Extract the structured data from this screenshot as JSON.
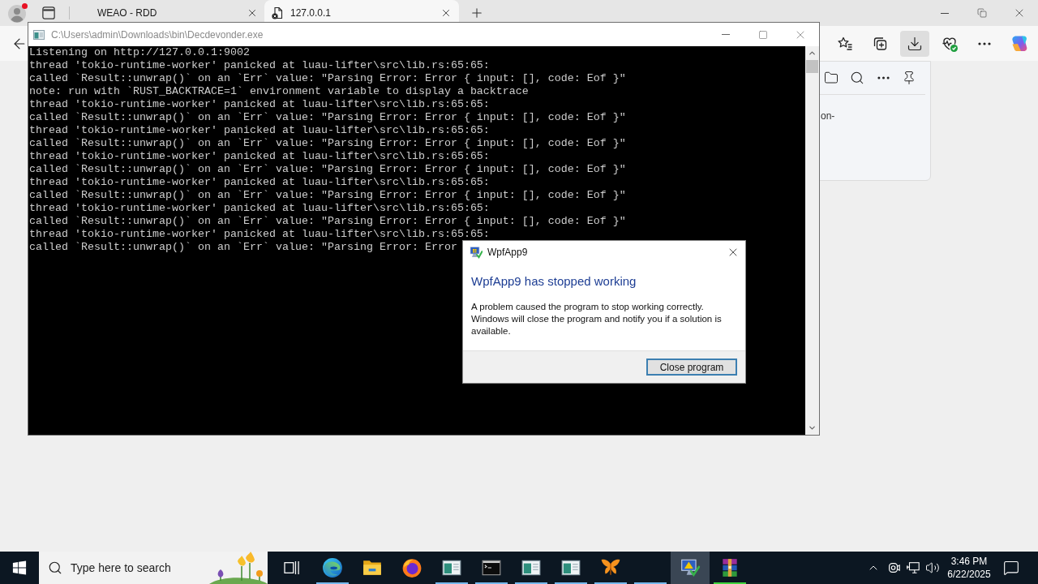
{
  "browser": {
    "tabs": [
      {
        "title": "WEAO - RDD",
        "kind": "plain",
        "selected": false
      },
      {
        "title": "127.0.0.1",
        "kind": "file-error",
        "selected": true
      }
    ],
    "toolbar": [
      {
        "kind": "favorites",
        "selected": false
      },
      {
        "kind": "collections",
        "selected": false
      },
      {
        "kind": "downloads",
        "selected": true
      },
      {
        "kind": "essentials",
        "selected": false
      },
      {
        "kind": "more",
        "selected": false
      },
      {
        "kind": "copilot",
        "selected": false
      }
    ],
    "downloads_panel": {
      "item_text": "on-"
    }
  },
  "console_window": {
    "title": "C:\\Users\\admin\\Downloads\\bin\\Decdevonder.exe",
    "lines": [
      "Listening on http://127.0.0.1:9002",
      "thread 'tokio-runtime-worker' panicked at luau-lifter\\src\\lib.rs:65:65:",
      "called `Result::unwrap()` on an `Err` value: \"Parsing Error: Error { input: [], code: Eof }\"",
      "note: run with `RUST_BACKTRACE=1` environment variable to display a backtrace",
      "thread 'tokio-runtime-worker' panicked at luau-lifter\\src\\lib.rs:65:65:",
      "called `Result::unwrap()` on an `Err` value: \"Parsing Error: Error { input: [], code: Eof }\"",
      "thread 'tokio-runtime-worker' panicked at luau-lifter\\src\\lib.rs:65:65:",
      "called `Result::unwrap()` on an `Err` value: \"Parsing Error: Error { input: [], code: Eof }\"",
      "thread 'tokio-runtime-worker' panicked at luau-lifter\\src\\lib.rs:65:65:",
      "called `Result::unwrap()` on an `Err` value: \"Parsing Error: Error { input: [], code: Eof }\"",
      "thread 'tokio-runtime-worker' panicked at luau-lifter\\src\\lib.rs:65:65:",
      "called `Result::unwrap()` on an `Err` value: \"Parsing Error: Error { input: [], code: Eof }\"",
      "thread 'tokio-runtime-worker' panicked at luau-lifter\\src\\lib.rs:65:65:",
      "called `Result::unwrap()` on an `Err` value: \"Parsing Error: Error { input: [], code: Eof }\"",
      "thread 'tokio-runtime-worker' panicked at luau-lifter\\src\\lib.rs:65:65:",
      "called `Result::unwrap()` on an `Err` value: \"Parsing Error: Error"
    ]
  },
  "error_dialog": {
    "title": "WpfApp9",
    "heading": "WpfApp9 has stopped working",
    "message": "A problem caused the program to stop working correctly. Windows will close the program and notify you if a solution is available.",
    "button": "Close program"
  },
  "taskbar": {
    "search": {
      "placeholder": "Type here to search"
    },
    "apps": [
      {
        "kind": "browser",
        "running": true,
        "selected": false
      },
      {
        "kind": "folder",
        "running": false,
        "selected": false
      },
      {
        "kind": "fox-browser",
        "running": false,
        "selected": false
      },
      {
        "kind": "app-window",
        "running": true,
        "selected": false
      },
      {
        "kind": "terminal",
        "running": true,
        "selected": false
      },
      {
        "kind": "app-window",
        "running": true,
        "selected": false
      },
      {
        "kind": "app-window",
        "running": true,
        "selected": false
      },
      {
        "kind": "butterfly",
        "running": true,
        "selected": false
      },
      {
        "kind": "blank",
        "running": true,
        "selected": false
      },
      {
        "kind": "monitor-warning",
        "running": false,
        "selected": true
      },
      {
        "kind": "archive",
        "running": true,
        "selected": false,
        "color": "#3fd43f"
      }
    ],
    "clock": {
      "time": "3:46 PM",
      "date": "6/22/2025"
    }
  }
}
